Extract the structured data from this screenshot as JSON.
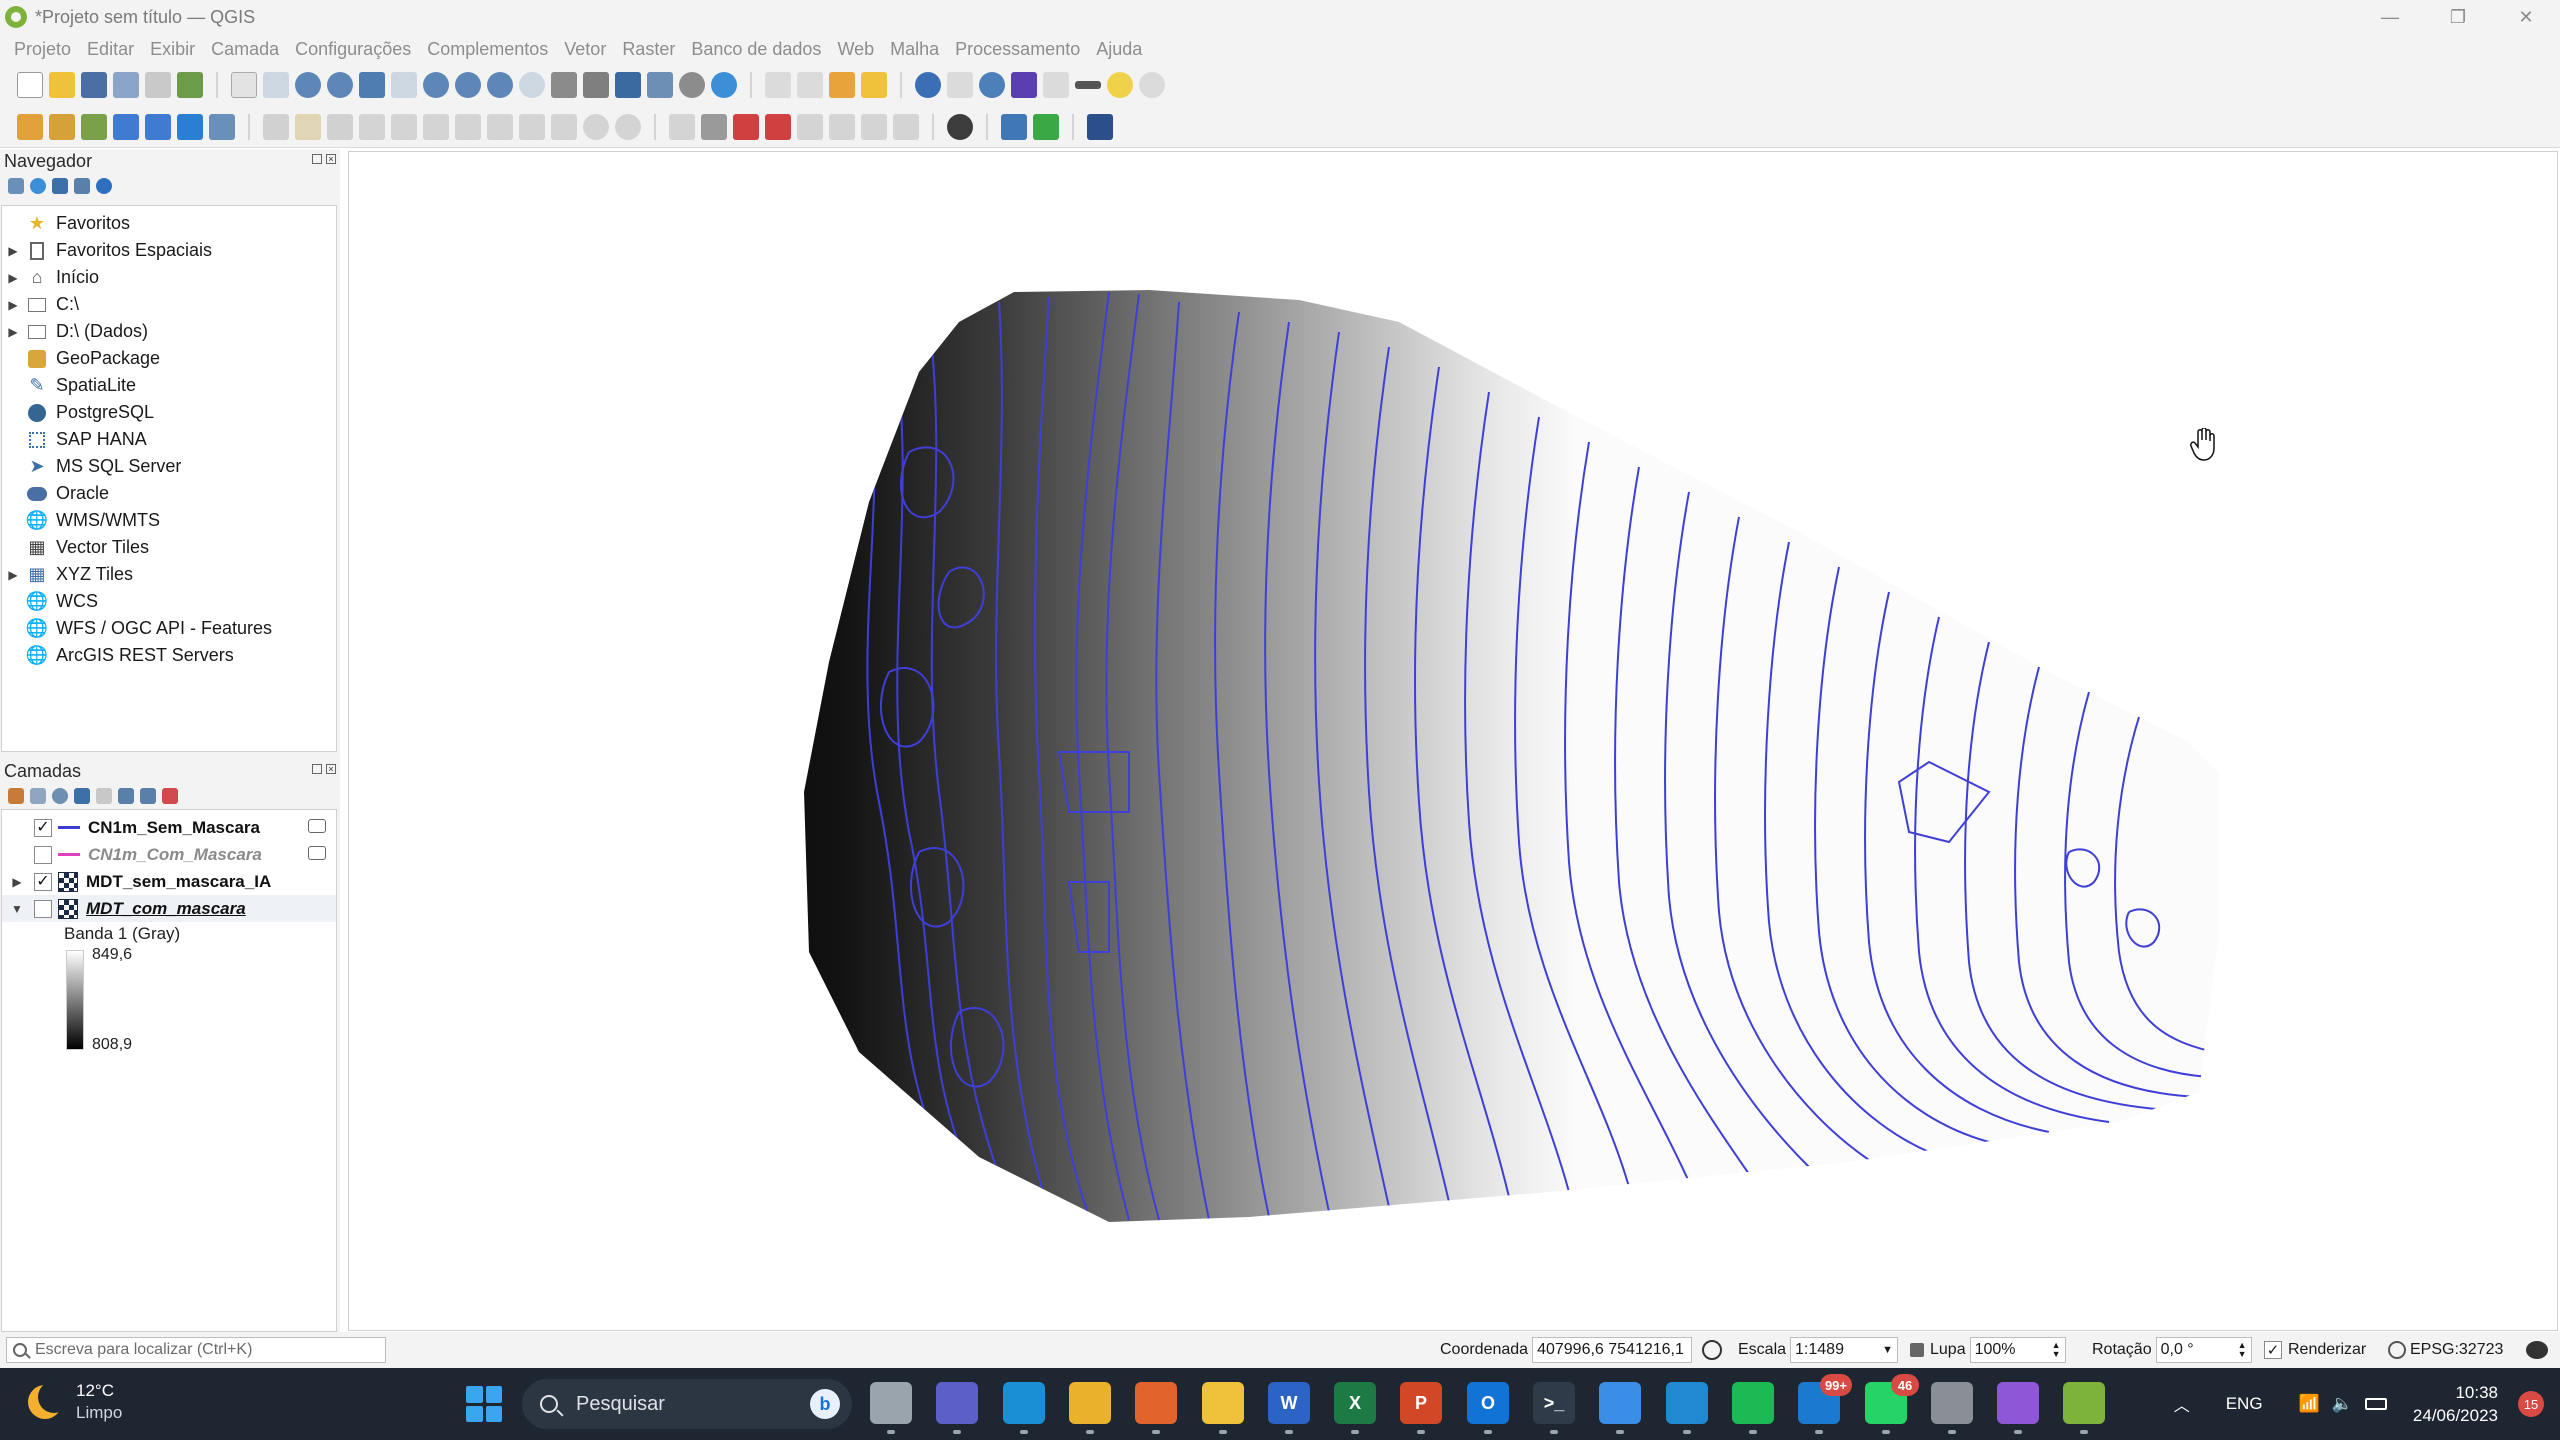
{
  "window": {
    "title": "*Projeto sem título — QGIS",
    "controls": {
      "minimize": "—",
      "maximize": "❐",
      "close": "✕"
    }
  },
  "menubar": [
    "Projeto",
    "Editar",
    "Exibir",
    "Camada",
    "Configurações",
    "Complementos",
    "Vetor",
    "Raster",
    "Banco de dados",
    "Web",
    "Malha",
    "Processamento",
    "Ajuda"
  ],
  "navigator": {
    "title": "Navegador",
    "items": [
      {
        "label": "Favoritos",
        "icon": "star-icon",
        "expandable": false
      },
      {
        "label": "Favoritos Espaciais",
        "icon": "bookmark-icon",
        "expandable": true
      },
      {
        "label": "Início",
        "icon": "home-icon",
        "expandable": true
      },
      {
        "label": "C:\\",
        "icon": "folder-icon",
        "expandable": true
      },
      {
        "label": "D:\\ (Dados)",
        "icon": "folder-icon",
        "expandable": true
      },
      {
        "label": "GeoPackage",
        "icon": "geopackage-icon",
        "expandable": false
      },
      {
        "label": "SpatiaLite",
        "icon": "spatialite-icon",
        "expandable": false
      },
      {
        "label": "PostgreSQL",
        "icon": "postgresql-icon",
        "expandable": false
      },
      {
        "label": "SAP HANA",
        "icon": "sap-hana-icon",
        "expandable": false
      },
      {
        "label": "MS SQL Server",
        "icon": "mssql-icon",
        "expandable": false
      },
      {
        "label": "Oracle",
        "icon": "oracle-icon",
        "expandable": false
      },
      {
        "label": "WMS/WMTS",
        "icon": "wms-icon",
        "expandable": false
      },
      {
        "label": "Vector Tiles",
        "icon": "vector-tiles-icon",
        "expandable": false
      },
      {
        "label": "XYZ Tiles",
        "icon": "xyz-tiles-icon",
        "expandable": true
      },
      {
        "label": "WCS",
        "icon": "wcs-icon",
        "expandable": false
      },
      {
        "label": "WFS / OGC API - Features",
        "icon": "wfs-icon",
        "expandable": false
      },
      {
        "label": "ArcGIS REST Servers",
        "icon": "arcgis-icon",
        "expandable": false
      }
    ]
  },
  "layers": {
    "title": "Camadas",
    "items": [
      {
        "name": "CN1m_Sem_Mascara",
        "checked": true,
        "type": "line",
        "color": "#3b3bd6",
        "style": "bold"
      },
      {
        "name": "CN1m_Com_Mascara",
        "checked": false,
        "type": "line",
        "color": "#e040c0",
        "style": "gray"
      },
      {
        "name": "MDT_sem_mascara_IA",
        "checked": true,
        "type": "raster",
        "style": "bold"
      },
      {
        "name": "MDT_com_mascara",
        "checked": false,
        "type": "raster",
        "style": "italic"
      }
    ],
    "legend": {
      "band": "Banda 1 (Gray)",
      "max": "849,6",
      "min": "808,9"
    }
  },
  "statusbar": {
    "locator_placeholder": "Escreva para localizar (Ctrl+K)",
    "coord_label": "Coordenada",
    "coord_value": "407996,6  7541216,1",
    "scale_label": "Escala",
    "scale_value": "1:1489",
    "magnifier_label": "Lupa",
    "magnifier_value": "100%",
    "rotation_label": "Rotação",
    "rotation_value": "0,0 °",
    "render_label": "Renderizar",
    "crs": "EPSG:32723"
  },
  "taskbar": {
    "weather_temp": "12°C",
    "weather_cond": "Limpo",
    "search_placeholder": "Pesquisar",
    "apps": [
      {
        "name": "task-view",
        "color": "#9aa4ad",
        "glyph": ""
      },
      {
        "name": "teams",
        "color": "#5b5fc7",
        "glyph": ""
      },
      {
        "name": "edge",
        "color": "#1a8fd6",
        "glyph": ""
      },
      {
        "name": "chrome",
        "color": "#e9b22a",
        "glyph": ""
      },
      {
        "name": "firefox",
        "color": "#e2632b",
        "glyph": ""
      },
      {
        "name": "file-explorer",
        "color": "#f0c23c",
        "glyph": ""
      },
      {
        "name": "word",
        "color": "#2b64c4",
        "glyph": "W"
      },
      {
        "name": "excel",
        "color": "#1e7a44",
        "glyph": "X"
      },
      {
        "name": "powerpoint",
        "color": "#d24726",
        "glyph": "P"
      },
      {
        "name": "outlook",
        "color": "#1273d6",
        "glyph": "O"
      },
      {
        "name": "terminal",
        "color": "#2f3b48",
        "glyph": ">_"
      },
      {
        "name": "paint",
        "color": "#3b8ee6",
        "glyph": ""
      },
      {
        "name": "vscode",
        "color": "#1f8ad2",
        "glyph": ""
      },
      {
        "name": "spotify",
        "color": "#1db954",
        "glyph": ""
      },
      {
        "name": "mail",
        "color": "#1b7ad0",
        "glyph": "",
        "badge": "99+"
      },
      {
        "name": "whatsapp",
        "color": "#25d366",
        "glyph": "",
        "badge": "46"
      },
      {
        "name": "cat-app",
        "color": "#8a8f96",
        "glyph": ""
      },
      {
        "name": "clipchamp",
        "color": "#8e57d8",
        "glyph": ""
      },
      {
        "name": "qgis",
        "color": "#7eb33b",
        "glyph": ""
      }
    ],
    "language": "ENG",
    "time": "10:38",
    "date": "24/06/2023",
    "notifications": "15"
  }
}
